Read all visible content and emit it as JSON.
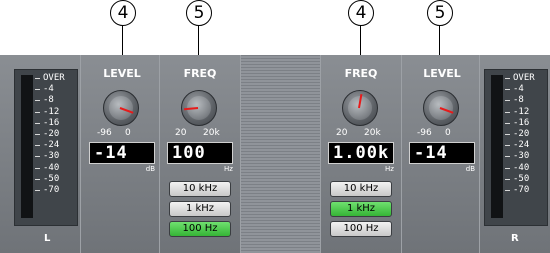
{
  "callouts": [
    "4",
    "5",
    "4",
    "5"
  ],
  "left_meter": {
    "scale": [
      "OVER",
      "-4",
      "-8",
      "-12",
      "-16",
      "-20",
      "-24",
      "-30",
      "-40",
      "-50",
      "-70"
    ],
    "channel": "L"
  },
  "right_meter": {
    "scale": [
      "OVER",
      "-4",
      "-8",
      "-12",
      "-16",
      "-20",
      "-24",
      "-30",
      "-40",
      "-50",
      "-70"
    ],
    "channel": "R"
  },
  "left_level": {
    "title": "LEVEL",
    "range_lo": "-96",
    "range_hi": "0",
    "value": "-14",
    "unit": "dB"
  },
  "left_freq": {
    "title": "FREQ",
    "range_lo": "20",
    "range_hi": "20k",
    "value": "100",
    "unit": "Hz",
    "presets": [
      "10 kHz",
      "1 kHz",
      "100 Hz"
    ],
    "active_preset": "100 Hz"
  },
  "right_freq": {
    "title": "FREQ",
    "range_lo": "20",
    "range_hi": "20k",
    "value": "1.00k",
    "unit": "Hz",
    "presets": [
      "10 kHz",
      "1 kHz",
      "100 Hz"
    ],
    "active_preset": "1 kHz"
  },
  "right_level": {
    "title": "LEVEL",
    "range_lo": "-96",
    "range_hi": "0",
    "value": "-14",
    "unit": "dB"
  },
  "colors": {
    "panel": "#7a7e84",
    "display_bg": "#000000",
    "active_button": "#3fc43f",
    "knob_indicator": "#e81a1a"
  }
}
